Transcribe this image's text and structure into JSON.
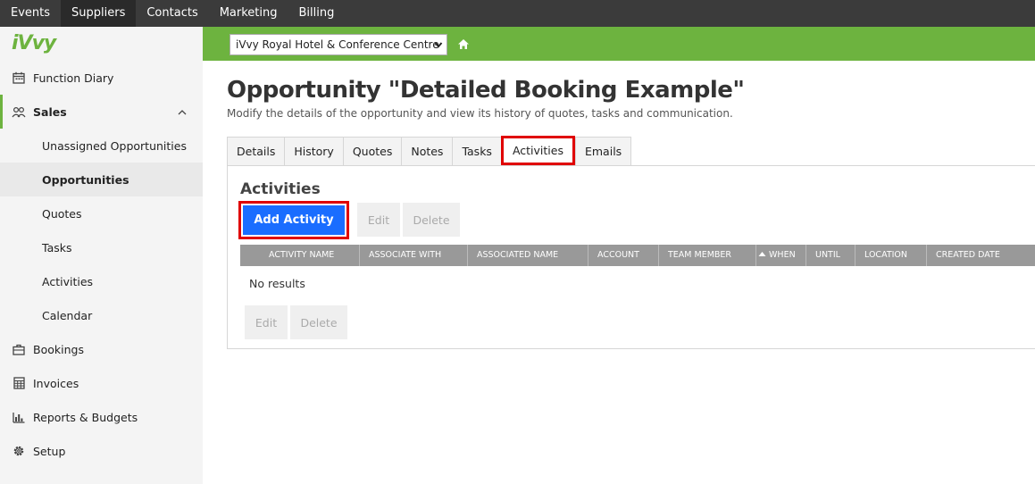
{
  "topnav": {
    "items": [
      "Events",
      "Suppliers",
      "Contacts",
      "Marketing",
      "Billing"
    ]
  },
  "sidebar": {
    "logo": "iVvy",
    "items": [
      {
        "label": "Function Diary",
        "icon": "calendar-icon"
      },
      {
        "label": "Sales",
        "icon": "users-icon"
      },
      {
        "label": "Unassigned Opportunities"
      },
      {
        "label": "Opportunities"
      },
      {
        "label": "Quotes"
      },
      {
        "label": "Tasks"
      },
      {
        "label": "Activities"
      },
      {
        "label": "Calendar"
      },
      {
        "label": "Bookings",
        "icon": "briefcase-icon"
      },
      {
        "label": "Invoices",
        "icon": "calculator-icon"
      },
      {
        "label": "Reports & Budgets",
        "icon": "bar-chart-icon"
      },
      {
        "label": "Setup",
        "icon": "gear-icon"
      }
    ]
  },
  "header": {
    "venue": "iVvy Royal Hotel & Conference Centre"
  },
  "main": {
    "title": "Opportunity \"Detailed Booking Example\"",
    "subtitle": "Modify the details of the opportunity and view its history of quotes, tasks and communication.",
    "tabs": [
      "Details",
      "History",
      "Quotes",
      "Notes",
      "Tasks",
      "Activities",
      "Emails"
    ],
    "active_tab": "Activities",
    "panel": {
      "heading": "Activities",
      "add_button": "Add Activity",
      "edit_button": "Edit",
      "delete_button": "Delete",
      "columns": [
        "ACTIVITY NAME",
        "ASSOCIATE WITH",
        "ASSOCIATED NAME",
        "ACCOUNT",
        "TEAM MEMBER",
        "WHEN",
        "UNTIL",
        "LOCATION",
        "CREATED DATE"
      ],
      "empty_text": "No results"
    }
  },
  "colors": {
    "brand_green": "#6db33f",
    "primary_blue": "#1a6dff",
    "highlight_red": "#e00000",
    "topnav_bg": "#3b3b3b"
  }
}
